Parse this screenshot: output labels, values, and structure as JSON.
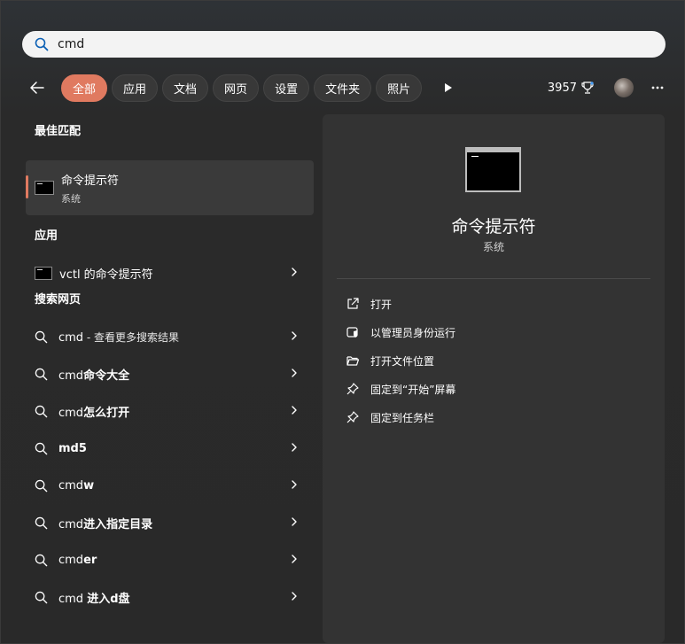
{
  "search": {
    "value": "cmd"
  },
  "filters": [
    {
      "label": "全部",
      "active": true
    },
    {
      "label": "应用",
      "active": false
    },
    {
      "label": "文档",
      "active": false
    },
    {
      "label": "网页",
      "active": false
    },
    {
      "label": "设置",
      "active": false
    },
    {
      "label": "文件夹",
      "active": false
    },
    {
      "label": "照片",
      "active": false
    }
  ],
  "points": "3957",
  "colors": {
    "accent": "#e07a60",
    "panel": "#333333",
    "background": "#292929"
  },
  "best_match": {
    "header": "最佳匹配",
    "title": "命令提示符",
    "subtitle": "系统"
  },
  "apps": {
    "header": "应用",
    "items": [
      {
        "label": "vctl 的命令提示符"
      }
    ]
  },
  "web": {
    "header": "搜索网页",
    "first": {
      "query": "cmd",
      "suffix": " - 查看更多搜索结果"
    },
    "items": [
      {
        "prefix": "cmd",
        "bold": "命令大全"
      },
      {
        "prefix": "cmd",
        "bold": "怎么打开"
      },
      {
        "prefix": "",
        "bold": "md5"
      },
      {
        "prefix": "cmd",
        "bold": "w"
      },
      {
        "prefix": "cmd",
        "bold": "进入指定目录"
      },
      {
        "prefix": "cmd",
        "bold": "er"
      },
      {
        "prefix": "cmd ",
        "bold": "进入d盘"
      }
    ]
  },
  "detail": {
    "title": "命令提示符",
    "subtitle": "系统",
    "actions": [
      {
        "label": "打开",
        "icon": "open-external-icon"
      },
      {
        "label": "以管理员身份运行",
        "icon": "admin-shield-icon"
      },
      {
        "label": "打开文件位置",
        "icon": "folder-open-icon"
      },
      {
        "label": "固定到“开始”屏幕",
        "icon": "pin-icon"
      },
      {
        "label": "固定到任务栏",
        "icon": "pin-icon"
      }
    ]
  }
}
